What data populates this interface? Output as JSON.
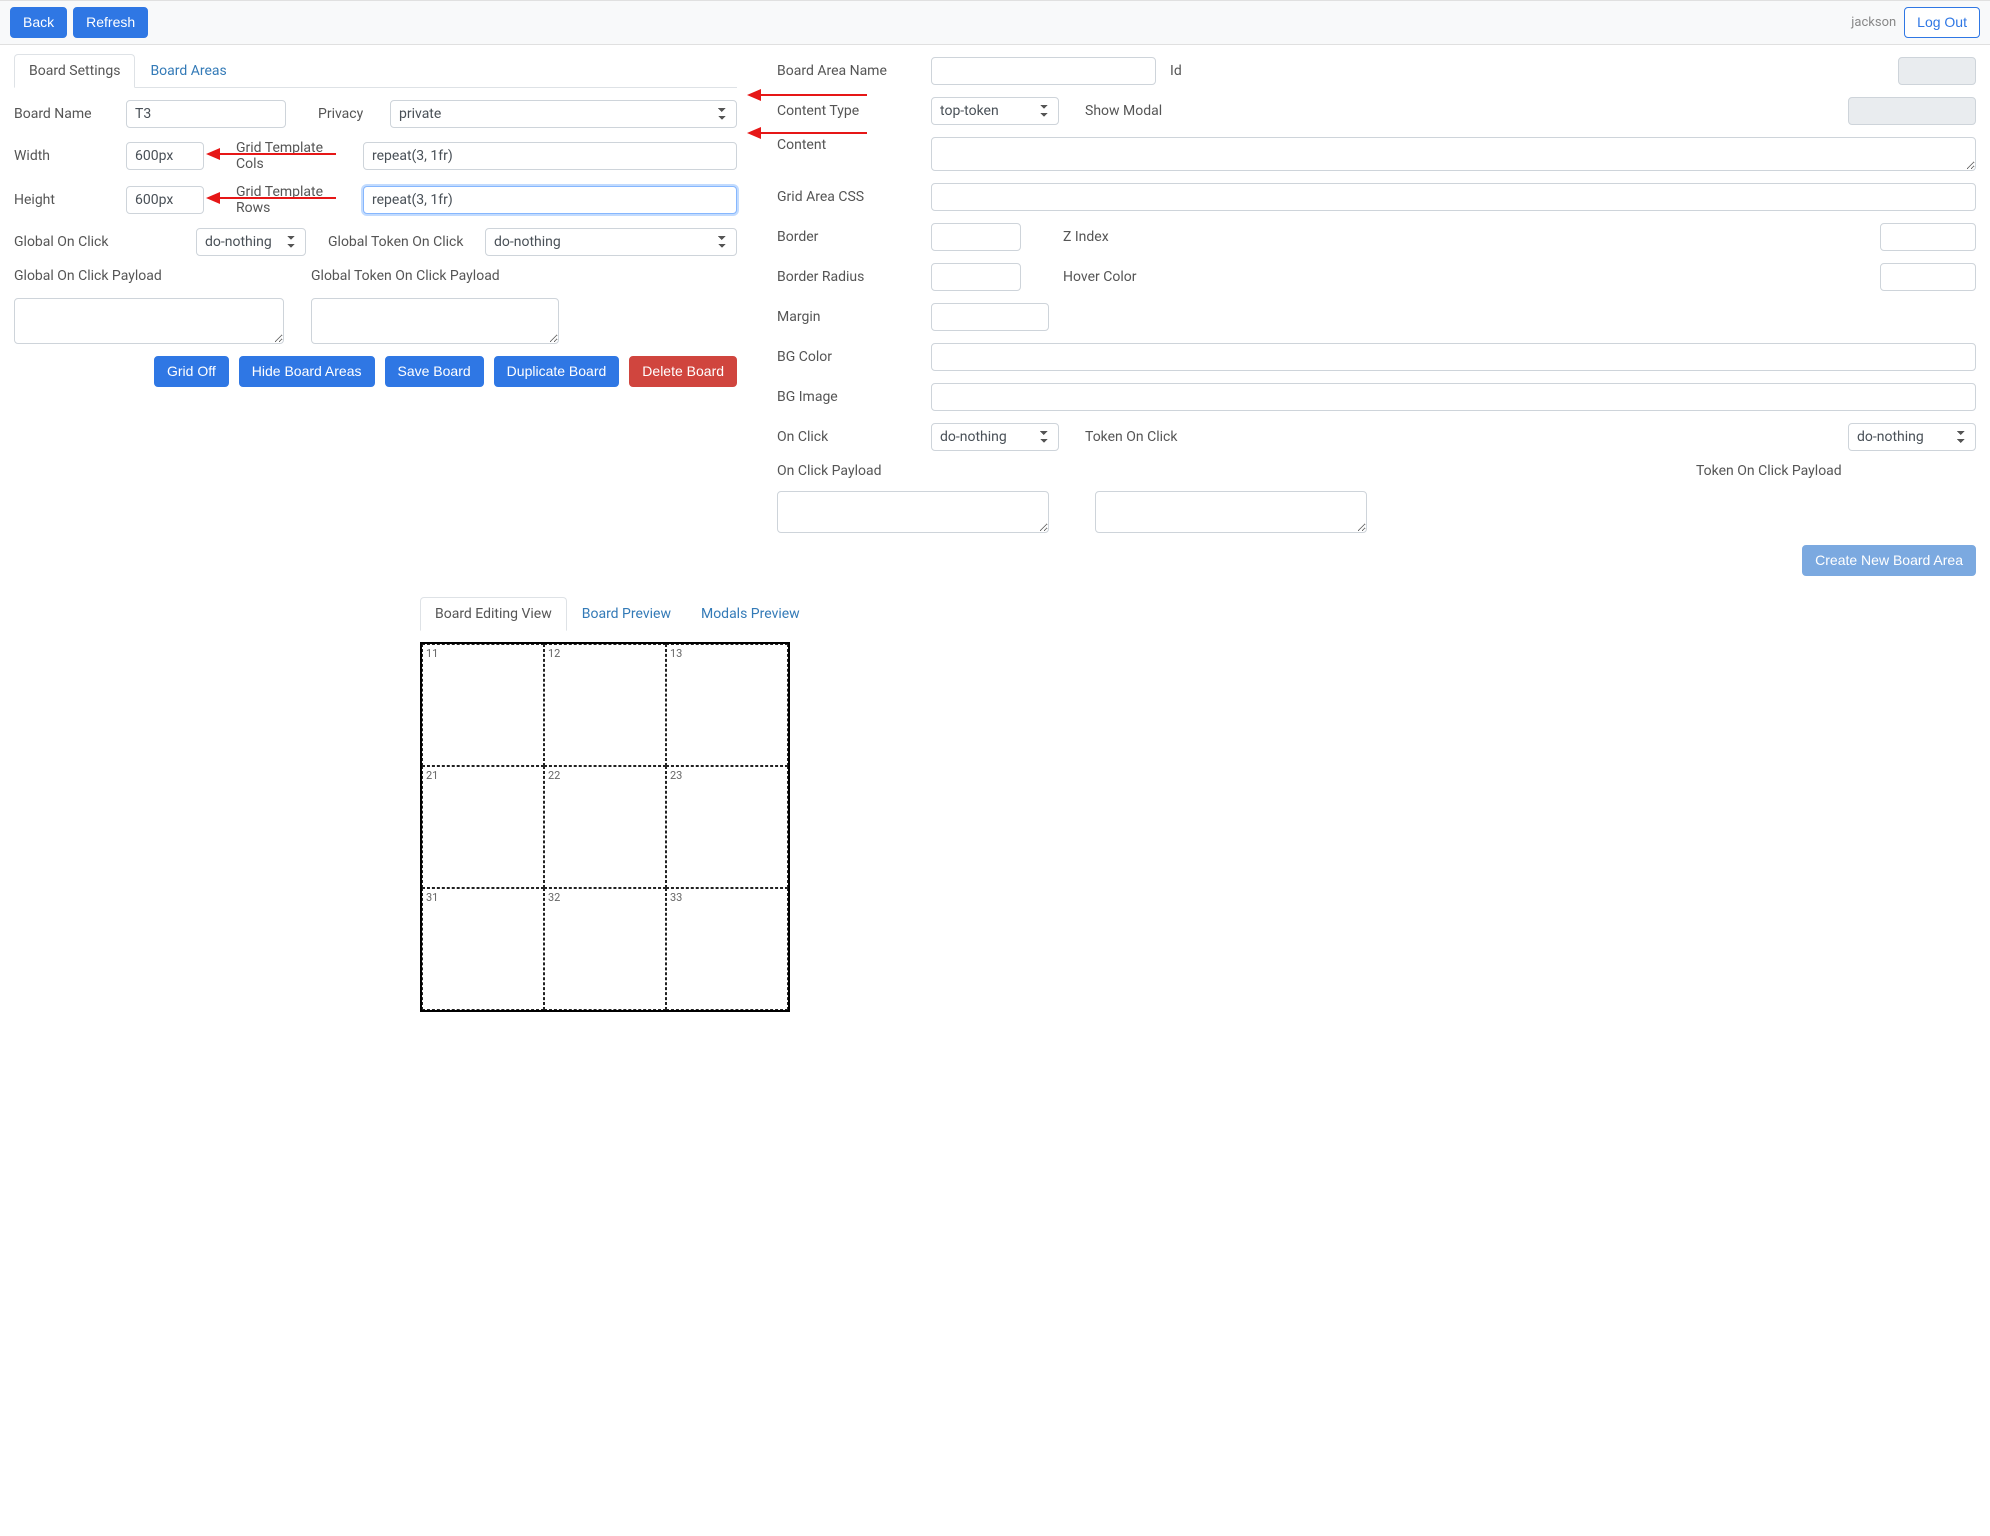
{
  "header": {
    "back": "Back",
    "refresh": "Refresh",
    "username": "jackson",
    "logout": "Log Out"
  },
  "leftTabs": {
    "settings": "Board Settings",
    "areas": "Board Areas"
  },
  "board": {
    "name_label": "Board Name",
    "name_value": "T3",
    "privacy_label": "Privacy",
    "privacy_value": "private",
    "width_label": "Width",
    "width_value": "600px",
    "height_label": "Height",
    "height_value": "600px",
    "cols_label": "Grid Template Cols",
    "cols_value": "repeat(3, 1fr)",
    "rows_label": "Grid Template Rows",
    "rows_value": "repeat(3, 1fr)",
    "gclick_label": "Global On Click",
    "gclick_value": "do-nothing",
    "gtoken_label": "Global Token On Click",
    "gtoken_value": "do-nothing",
    "gclick_payload_label": "Global On Click Payload",
    "gtoken_payload_label": "Global Token On Click Payload"
  },
  "boardActions": {
    "grid_off": "Grid Off",
    "hide_areas": "Hide Board Areas",
    "save": "Save Board",
    "duplicate": "Duplicate Board",
    "delete": "Delete Board"
  },
  "area": {
    "name_label": "Board Area Name",
    "id_label": "Id",
    "content_type_label": "Content Type",
    "content_type_value": "top-token",
    "show_modal_label": "Show Modal",
    "content_label": "Content",
    "grid_css_label": "Grid Area CSS",
    "border_label": "Border",
    "zindex_label": "Z Index",
    "radius_label": "Border Radius",
    "hover_label": "Hover Color",
    "margin_label": "Margin",
    "bgcolor_label": "BG Color",
    "bgimage_label": "BG Image",
    "onclick_label": "On Click",
    "onclick_value": "do-nothing",
    "tokenclick_label": "Token On Click",
    "tokenclick_value": "do-nothing",
    "onclick_payload_label": "On Click Payload",
    "tokenclick_payload_label": "Token On Click Payload",
    "create": "Create New Board Area"
  },
  "bottomTabs": {
    "editing": "Board Editing View",
    "preview": "Board Preview",
    "modals": "Modals Preview"
  },
  "gridCells": [
    "11",
    "12",
    "13",
    "21",
    "22",
    "23",
    "31",
    "32",
    "33"
  ]
}
